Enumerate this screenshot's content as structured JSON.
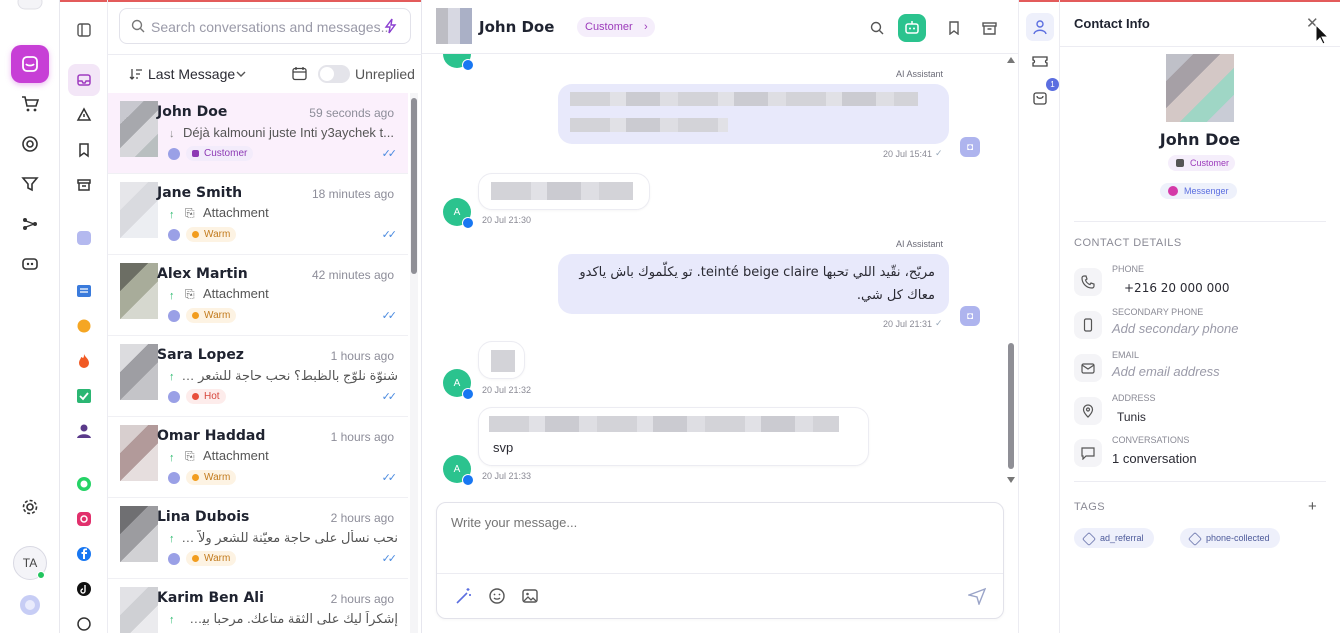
{
  "search": {
    "placeholder": "Search conversations and messages..."
  },
  "filters": {
    "sort_label": "Last Message",
    "unreplied_label": "Unreplied"
  },
  "conversations": [
    {
      "name": "John Doe",
      "time": "59 seconds ago",
      "message": "Déjà kalmouni juste Inti y3aychek t...",
      "tag": "Customer",
      "tag_type": "customer",
      "direction": "in"
    },
    {
      "name": "Jane Smith",
      "time": "18 minutes ago",
      "message": "Attachment",
      "tag": "Warm",
      "tag_type": "warm",
      "direction": "out"
    },
    {
      "name": "Alex Martin",
      "time": "42 minutes ago",
      "message": "Attachment",
      "tag": "Warm",
      "tag_type": "warm",
      "direction": "out"
    },
    {
      "name": "Sara Lopez",
      "time": "1 hours ago",
      "message": "شنوّة نلوّج بالظبط؟ نحب حاجة للشعر ولاّ للبو...",
      "tag": "Hot",
      "tag_type": "hot",
      "direction": "out"
    },
    {
      "name": "Omar Haddad",
      "time": "1 hours ago",
      "message": "Attachment",
      "tag": "Warm",
      "tag_type": "warm",
      "direction": "out"
    },
    {
      "name": "Lina Dubois",
      "time": "2 hours ago",
      "message": "نحب نسأل على حاجة معيّنة للشعر ولاّ للبشرة؟...",
      "tag": "Warm",
      "tag_type": "warm",
      "direction": "out"
    },
    {
      "name": "Karim Ben Ali",
      "time": "2 hours ago",
      "message": "إشكراً ليك على الثقة متاعك. مرحبا بيك ديما",
      "tag": "",
      "tag_type": "",
      "direction": "out"
    }
  ],
  "chat": {
    "contact_name": "John Doe",
    "contact_badge": "Customer",
    "messages": {
      "ai_label_1": "AI Assistant",
      "time_1": "20 Jul 15:41",
      "user_avatar_letter": "A",
      "time_2": "20 Jul 21:30",
      "ai_label_2": "AI Assistant",
      "arabic_text": "مريّح، نقّيد اللي تحبها teinté beige claire. تو يكلّموك باش ياكدو معاك كل شي.",
      "time_3": "20 Jul 21:31",
      "time_4": "20 Jul 21:32",
      "svp_text": "svp",
      "time_5": "20 Jul 21:33"
    },
    "composer_placeholder": "Write your message..."
  },
  "side": {
    "orders_count": "1"
  },
  "contact": {
    "title": "Contact Info",
    "name": "John Doe",
    "badge_customer": "Customer",
    "badge_channel": "Messenger",
    "details_title": "CONTACT DETAILS",
    "phone_label": "PHONE",
    "phone_value": "+216 20 000 000",
    "secondary_label": "SECONDARY PHONE",
    "secondary_value": "Add secondary phone",
    "email_label": "EMAIL",
    "email_value": "Add email address",
    "address_label": "ADDRESS",
    "address_value": "Tunis",
    "conversations_label": "CONVERSATIONS",
    "conversations_value": "1 conversation",
    "tags_title": "TAGS",
    "tags": [
      "ad_referral",
      "phone-collected"
    ]
  },
  "profile": {
    "initials": "TA"
  },
  "colors": {
    "accent": "#c73fd6",
    "bot": "#aeb4ee",
    "green": "#2bc38e",
    "link": "#5b6ee0"
  }
}
